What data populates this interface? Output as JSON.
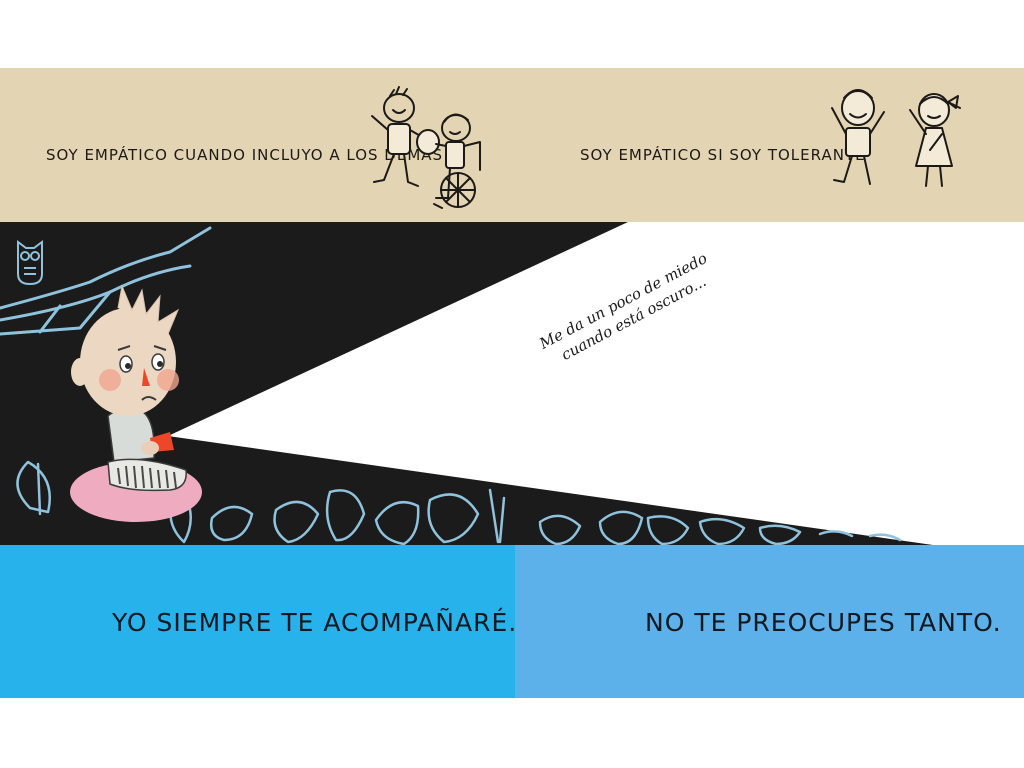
{
  "top_band": {
    "left_caption": "SOY EMPÁTICO CUANDO INCLUYO A LOS DEMÁS",
    "right_caption": "SOY EMPÁTICO SI SOY TOLERANTE"
  },
  "middle_scene": {
    "speech_line_1": "Me da un poco de miedo",
    "speech_line_2": "cuando está oscuro..."
  },
  "bottom_band": {
    "left_caption": "YO SIEMPRE TE ACOMPAÑARÉ.",
    "right_caption": "NO TE PREOCUPES TANTO."
  },
  "colors": {
    "top_band": "#e3d5b4",
    "night": "#1b1b1b",
    "left_blue": "#28b2ec",
    "right_blue": "#5cb1ea",
    "chalk": "#8fc2dd"
  }
}
